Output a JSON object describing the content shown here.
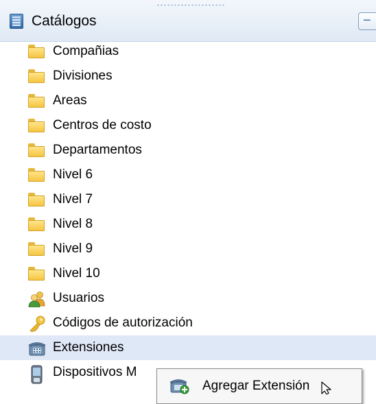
{
  "header": {
    "title": "Catálogos",
    "collapse_symbol": "−"
  },
  "tree": {
    "items": [
      {
        "label": "Compañias",
        "icon": "folder-icon"
      },
      {
        "label": "Divisiones",
        "icon": "folder-icon"
      },
      {
        "label": "Areas",
        "icon": "folder-icon"
      },
      {
        "label": "Centros de costo",
        "icon": "folder-icon"
      },
      {
        "label": "Departamentos",
        "icon": "folder-icon"
      },
      {
        "label": "Nivel 6",
        "icon": "folder-icon"
      },
      {
        "label": "Nivel 7",
        "icon": "folder-icon"
      },
      {
        "label": "Nivel 8",
        "icon": "folder-icon"
      },
      {
        "label": "Nivel 9",
        "icon": "folder-icon"
      },
      {
        "label": "Nivel 10",
        "icon": "folder-icon"
      },
      {
        "label": "Usuarios",
        "icon": "users-icon"
      },
      {
        "label": "Códigos de autorización",
        "icon": "key-icon"
      },
      {
        "label": "Extensiones",
        "icon": "phone-icon"
      },
      {
        "label": "Dispositivos M",
        "icon": "mobile-device-icon"
      }
    ]
  },
  "context_menu": {
    "items": [
      {
        "label": "Agregar Extensión",
        "icon": "add-phone-icon"
      }
    ]
  },
  "colors": {
    "header_bg": "#dfe9f5",
    "hover_row": "#dfe8f6",
    "folder": "#f5c542"
  }
}
